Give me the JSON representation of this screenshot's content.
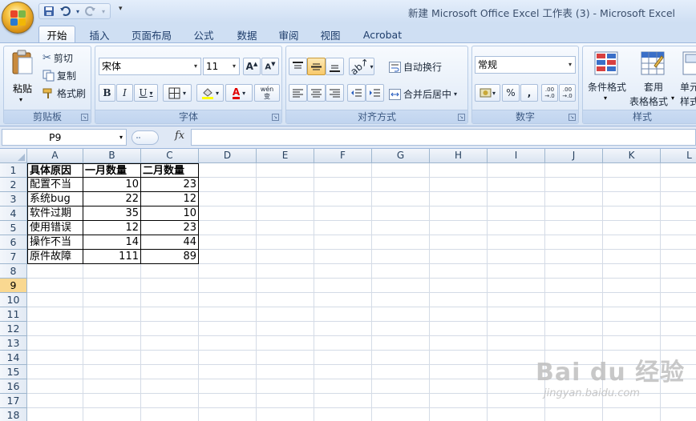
{
  "window": {
    "title": "新建 Microsoft Office Excel 工作表 (3) - Microsoft Excel"
  },
  "tabs": [
    "开始",
    "插入",
    "页面布局",
    "公式",
    "数据",
    "审阅",
    "视图",
    "Acrobat"
  ],
  "clipboard": {
    "paste": "粘贴",
    "cut": "剪切",
    "copy": "复制",
    "format_painter": "格式刷",
    "label": "剪贴板"
  },
  "font": {
    "name": "宋体",
    "size": "11",
    "bold": "B",
    "italic": "I",
    "underline": "U",
    "font_color_glyph": "A",
    "phonetic": "wén 变",
    "label": "字体"
  },
  "alignment": {
    "wrap_text": "自动换行",
    "merge_center": "合并后居中",
    "label": "对齐方式"
  },
  "number": {
    "format": "常规",
    "percent": "%",
    "comma": ",",
    "inc_decimal": ".00 →.0",
    "dec_decimal": ".00 →.0",
    "label": "数字"
  },
  "styles": {
    "conditional": "条件格式",
    "format_table_1": "套用",
    "format_table_2": "表格格式",
    "cell_styles_1": "单元",
    "cell_styles_2": "样式",
    "label": "样式"
  },
  "formula_bar": {
    "name_box": "P9",
    "fx": "fx",
    "value": ""
  },
  "columns": [
    "A",
    "B",
    "C",
    "D",
    "E",
    "F",
    "G",
    "H",
    "I",
    "J",
    "K",
    "L"
  ],
  "rows": [
    "1",
    "2",
    "3",
    "4",
    "5",
    "6",
    "7",
    "8",
    "9",
    "10",
    "11",
    "12",
    "13",
    "14",
    "15",
    "16",
    "17",
    "18"
  ],
  "selected_row": "9",
  "sheet": {
    "header": [
      "具体原因",
      "一月数量",
      "二月数量"
    ],
    "data": [
      [
        "配置不当",
        "10",
        "23"
      ],
      [
        "系统bug",
        "22",
        "12"
      ],
      [
        "软件过期",
        "35",
        "10"
      ],
      [
        "使用错误",
        "12",
        "23"
      ],
      [
        "操作不当",
        "14",
        "44"
      ],
      [
        "原件故障",
        "111",
        "89"
      ]
    ]
  },
  "watermark": {
    "main": "Bai du 经验",
    "sub": "jingyan.baidu.com"
  },
  "colors": {
    "accent": "#cfdff3",
    "selected_row": "#f9d891",
    "grid_line": "#d4dbe6"
  }
}
